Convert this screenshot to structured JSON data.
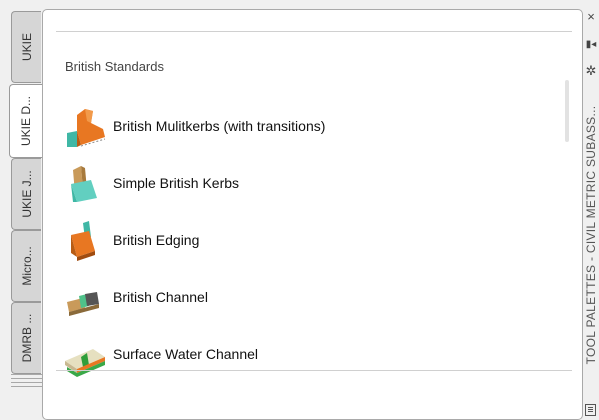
{
  "tabs": [
    {
      "label": "UKIE",
      "active": false
    },
    {
      "label": "UKIE D...",
      "active": true
    },
    {
      "label": "UKIE J...",
      "active": false
    },
    {
      "label": "Micro...",
      "active": false
    },
    {
      "label": "DMRB ...",
      "active": false
    }
  ],
  "palette": {
    "section_title": "British Standards",
    "items": [
      {
        "label": "British Mulitkerbs (with transitions)",
        "icon": "multikerb-icon"
      },
      {
        "label": "Simple British Kerbs",
        "icon": "kerb-icon"
      },
      {
        "label": "British Edging",
        "icon": "edging-icon"
      },
      {
        "label": "British Channel",
        "icon": "channel-icon"
      },
      {
        "label": "Surface Water Channel",
        "icon": "water-channel-icon"
      }
    ]
  },
  "titlebar": {
    "title": "TOOL PALETTES - CIVIL METRIC SUBASS...",
    "close_glyph": "×",
    "autohide_glyph": "▮◂",
    "properties_glyph": "✲"
  },
  "colors": {
    "accent": "#e87722",
    "teal": "#3fb7a5"
  }
}
